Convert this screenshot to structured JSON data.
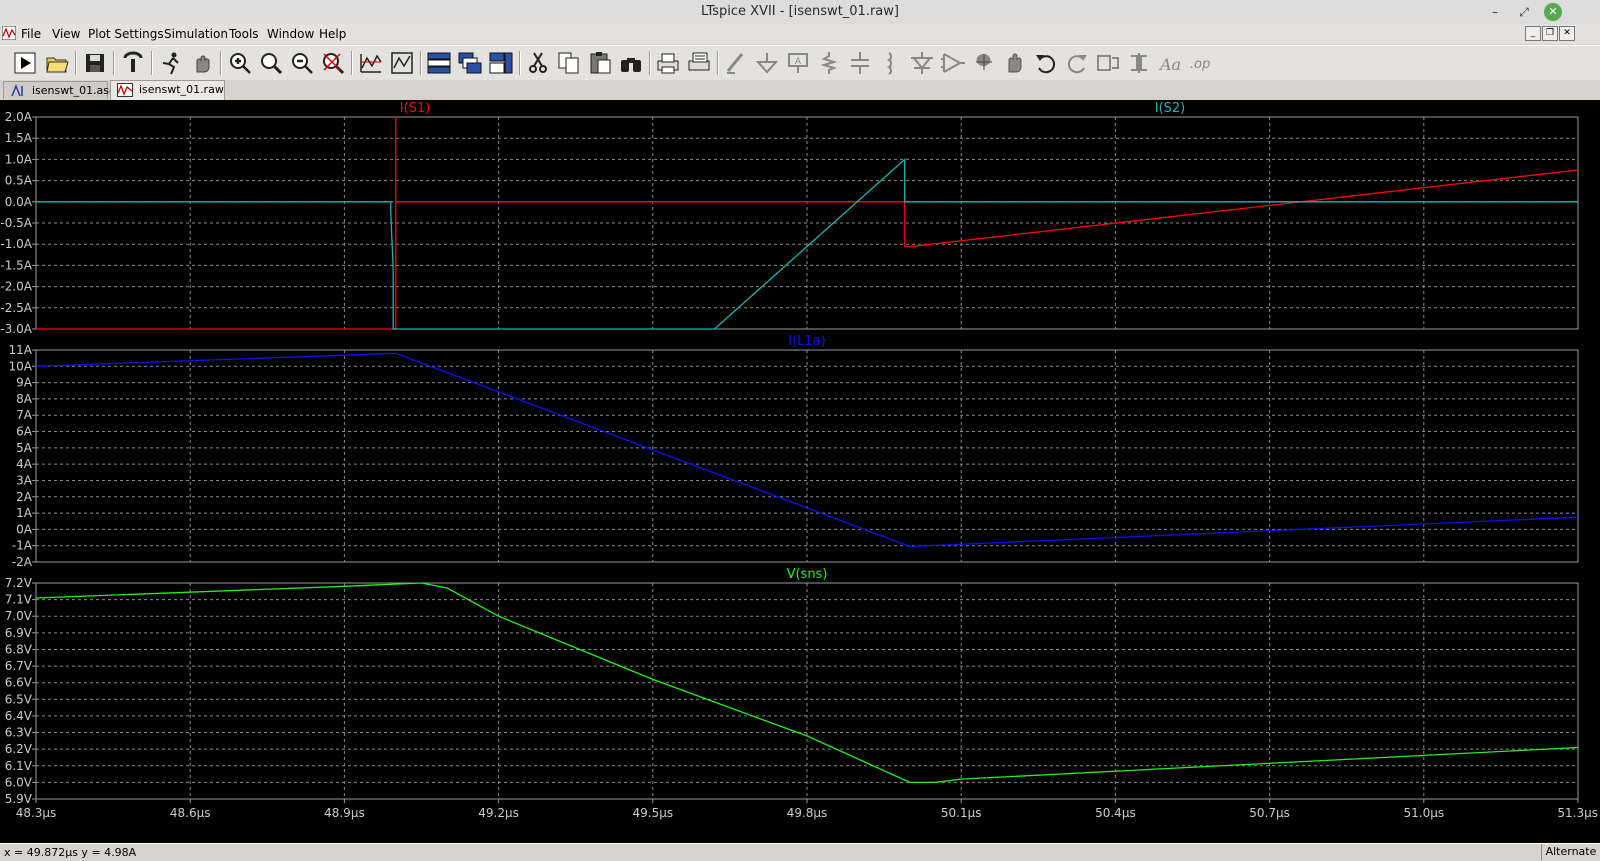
{
  "window": {
    "title": "LTspice XVII - [isenswt_01.raw]"
  },
  "menu": [
    "File",
    "View",
    "Plot Settings",
    "Simulation",
    "Tools",
    "Window",
    "Help"
  ],
  "toolbar_icons": [
    "run-icon",
    "open-icon",
    "save-icon",
    "control-panel-icon",
    "halt-icon",
    "pan-icon",
    "zoom-in-icon",
    "zoom-area-icon",
    "zoom-out-icon",
    "zoom-fit-icon",
    "autorange-icon",
    "plot-settings-icon",
    "tile-horizontal-icon",
    "cascade-icon",
    "tile-vertical-icon",
    "cut-icon",
    "copy-icon",
    "paste-icon",
    "find-icon",
    "print-icon",
    "print-setup-icon",
    "draw-wire-icon",
    "ground-icon",
    "label-net-icon",
    "resistor-icon",
    "capacitor-icon",
    "inductor-icon",
    "diode-icon",
    "component-icon",
    "rotate-icon",
    "mirror-icon",
    "undo-icon",
    "redo-icon",
    "text-icon",
    "spice-directive-icon",
    "spice-op-icon"
  ],
  "tabs": [
    {
      "label": "isenswt_01.asc",
      "icon": "schematic-icon"
    },
    {
      "label": "isenswt_01.raw",
      "icon": "waveform-icon"
    }
  ],
  "colors": {
    "s1": "#ff0000",
    "s2": "#1fb2b2",
    "l1a": "#1010ee",
    "sns": "#22ee22",
    "axis_text": "#cccccc",
    "grid": "#8a8a8a"
  },
  "chart_data": [
    {
      "type": "line",
      "title": "",
      "xlim": [
        48.3,
        51.3
      ],
      "ylim": [
        -3.0,
        2.0
      ],
      "yticks": [
        "2.0A",
        "1.5A",
        "1.0A",
        "0.5A",
        "0.0A",
        "-0.5A",
        "-1.0A",
        "-1.5A",
        "-2.0A",
        "-2.5A",
        "-3.0A"
      ],
      "series": [
        {
          "name": "I(S1)",
          "color": "#ff0000",
          "x": [
            48.3,
            49.0,
            49.0,
            49.0,
            49.0,
            49.99,
            49.99,
            50.0,
            51.3
          ],
          "y": [
            -3.0,
            -3.0,
            2.0,
            2.0,
            0.0,
            0.0,
            -1.05,
            -1.06,
            0.75
          ]
        },
        {
          "name": "I(S2)",
          "color": "#1fb2b2",
          "x": [
            48.3,
            48.99,
            48.99,
            48.995,
            48.995,
            49.62,
            49.99,
            49.99,
            50.0,
            51.3
          ],
          "y": [
            0.0,
            0.0,
            -0.2,
            -1.6,
            -3.0,
            -3.0,
            1.0,
            0.0,
            0.0,
            0.0
          ]
        }
      ]
    },
    {
      "type": "line",
      "title": "",
      "xlim": [
        48.3,
        51.3
      ],
      "ylim": [
        -2,
        11
      ],
      "yticks": [
        "11A",
        "10A",
        "9A",
        "8A",
        "7A",
        "6A",
        "5A",
        "4A",
        "3A",
        "2A",
        "1A",
        "0A",
        "-1A",
        "-2A"
      ],
      "series": [
        {
          "name": "I(L1a)",
          "color": "#1010ee",
          "x": [
            48.3,
            49.0,
            50.0,
            51.3
          ],
          "y": [
            10.0,
            10.8,
            -1.05,
            0.75
          ]
        }
      ]
    },
    {
      "type": "line",
      "title": "",
      "xlim": [
        48.3,
        51.3
      ],
      "ylim": [
        5.9,
        7.2
      ],
      "yticks": [
        "7.2V",
        "7.1V",
        "7.0V",
        "6.9V",
        "6.8V",
        "6.7V",
        "6.6V",
        "6.5V",
        "6.4V",
        "6.3V",
        "6.2V",
        "6.1V",
        "6.0V",
        "5.9V"
      ],
      "xticks": [
        "48.3µs",
        "48.6µs",
        "48.9µs",
        "49.2µs",
        "49.5µs",
        "49.8µs",
        "50.1µs",
        "50.4µs",
        "50.7µs",
        "51.0µs",
        "51.3µs"
      ],
      "series": [
        {
          "name": "V(sns)",
          "color": "#22ee22",
          "x": [
            48.3,
            48.9,
            49.05,
            49.1,
            49.2,
            49.5,
            49.8,
            50.0,
            50.05,
            50.1,
            51.3
          ],
          "y": [
            7.11,
            7.18,
            7.2,
            7.17,
            7.0,
            6.62,
            6.28,
            6.0,
            6.0,
            6.02,
            6.21
          ]
        }
      ]
    }
  ],
  "status": {
    "coords": "x = 49.872µs    y = 4.98A",
    "mode": "Alternate"
  }
}
